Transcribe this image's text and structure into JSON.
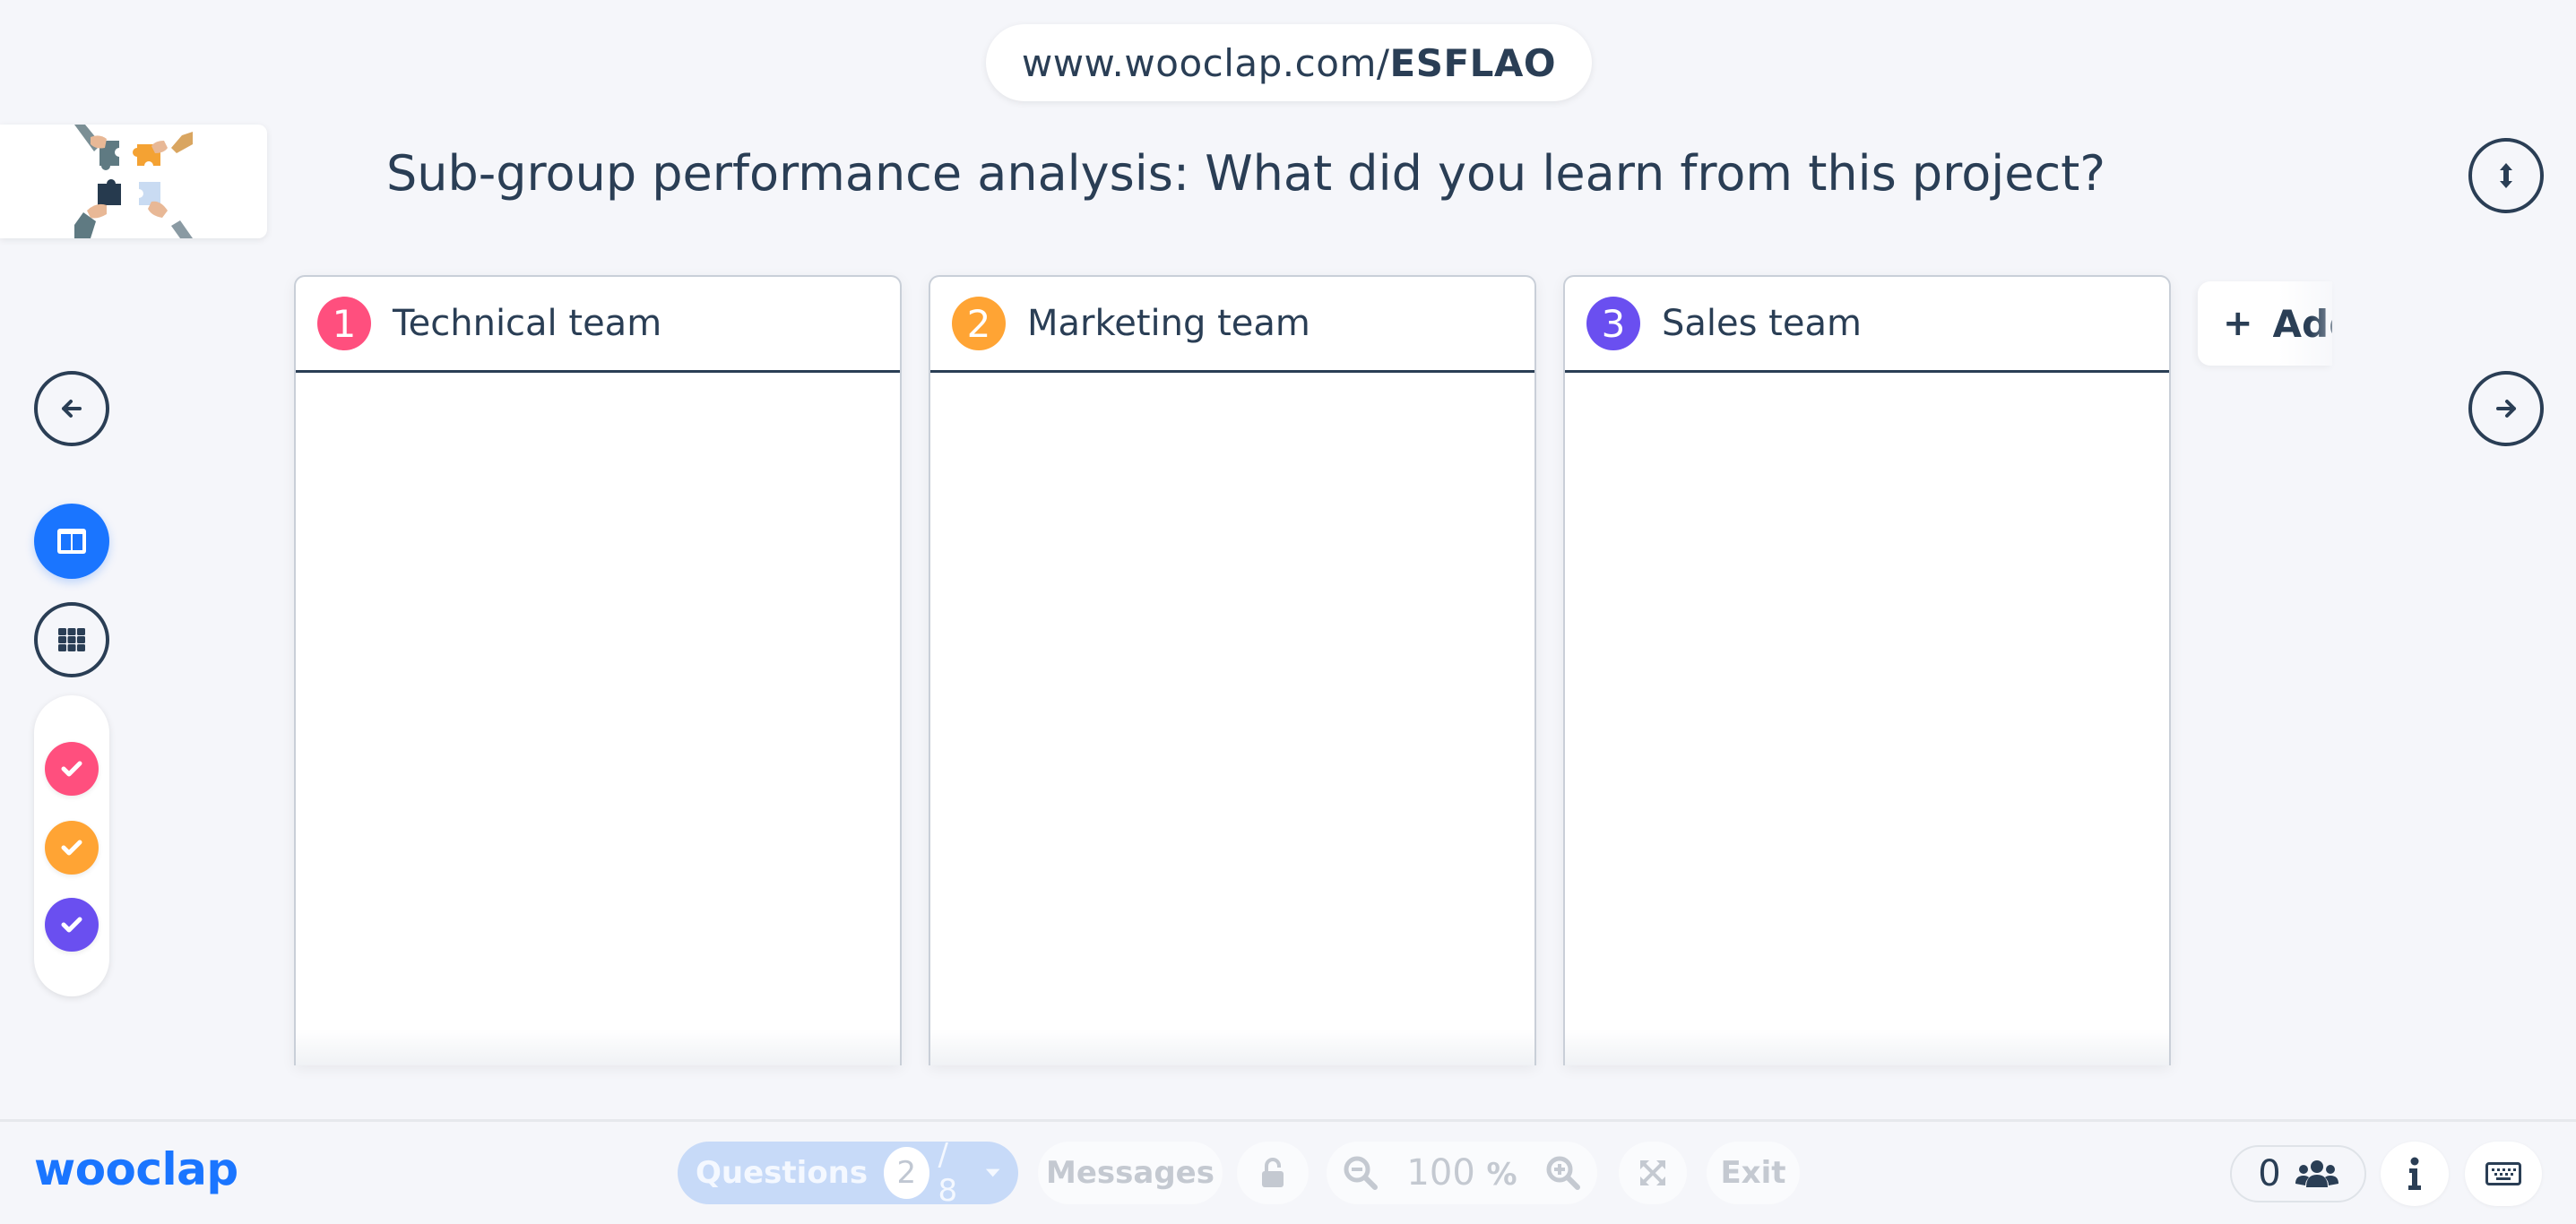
{
  "header": {
    "url_prefix": "www.wooclap.com/",
    "event_code": "ESFLAO",
    "question_title": "Sub-group performance analysis: What did you learn from this project?"
  },
  "thumbnail": {
    "alt": "puzzle-hands-image"
  },
  "left_controls": {
    "prev_icon": "arrow-left-icon",
    "columns_view_icon": "columns-view-icon",
    "grid_view_icon": "grid-view-icon",
    "filters": [
      {
        "color": "#ff4f7e",
        "checked": true
      },
      {
        "color": "#ffa434",
        "checked": true
      },
      {
        "color": "#6a4ff0",
        "checked": true
      }
    ]
  },
  "columns": [
    {
      "number": "1",
      "title": "Technical team",
      "color": "#ff4f7e"
    },
    {
      "number": "2",
      "title": "Marketing team",
      "color": "#ffa434"
    },
    {
      "number": "3",
      "title": "Sales team",
      "color": "#6a4ff0"
    }
  ],
  "add_column": {
    "plus": "+",
    "label": "Add"
  },
  "bottom_bar": {
    "logo": "wooclap",
    "questions_label": "Questions",
    "current_question": "2",
    "total_questions": "/ 8",
    "messages_label": "Messages",
    "zoom_value": "100",
    "zoom_unit": "%",
    "exit_label": "Exit",
    "participants_count": "0"
  },
  "colors": {
    "brand": "#1a75ff",
    "text": "#2a3e55",
    "background": "#f5f6fa"
  }
}
